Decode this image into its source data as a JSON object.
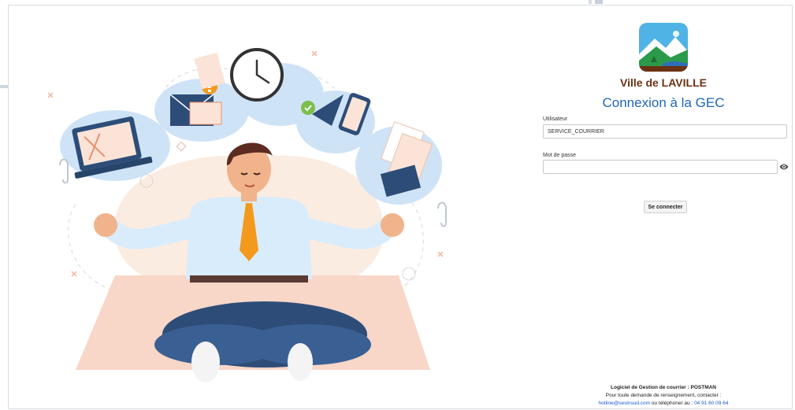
{
  "brand": {
    "name": "Ville de LAVILLE",
    "logo_icon": "mountain-landscape-logo-icon",
    "colors": {
      "brand": "#6b3212",
      "title": "#1f66b5",
      "link": "#1c58c9"
    }
  },
  "login": {
    "title": "Connexion à la GEC",
    "user_label": "Utilisateur",
    "user_value": "SERVICE_COURRIER",
    "password_label": "Mot de passe",
    "password_value": "",
    "show_password_icon": "eye-icon",
    "submit_label": "Se connecter"
  },
  "footer": {
    "line1": "Logiciel de Gestion de courrier : POSTMAN",
    "line2": "Pour toute demande de renseignement, contacter :",
    "email": "hotline@sesinsud.com",
    "or_phone": " ou téléphoner au : ",
    "phone": "04 91 60 09 64"
  },
  "illustration": {
    "subject": "meditating-office-worker-illustration",
    "icons": [
      "laptop-icon",
      "envelope-icon",
      "alert-icon",
      "clock-icon",
      "paper-plane-icon",
      "smartphone-icon",
      "document-icon",
      "paperclip-icon"
    ]
  }
}
